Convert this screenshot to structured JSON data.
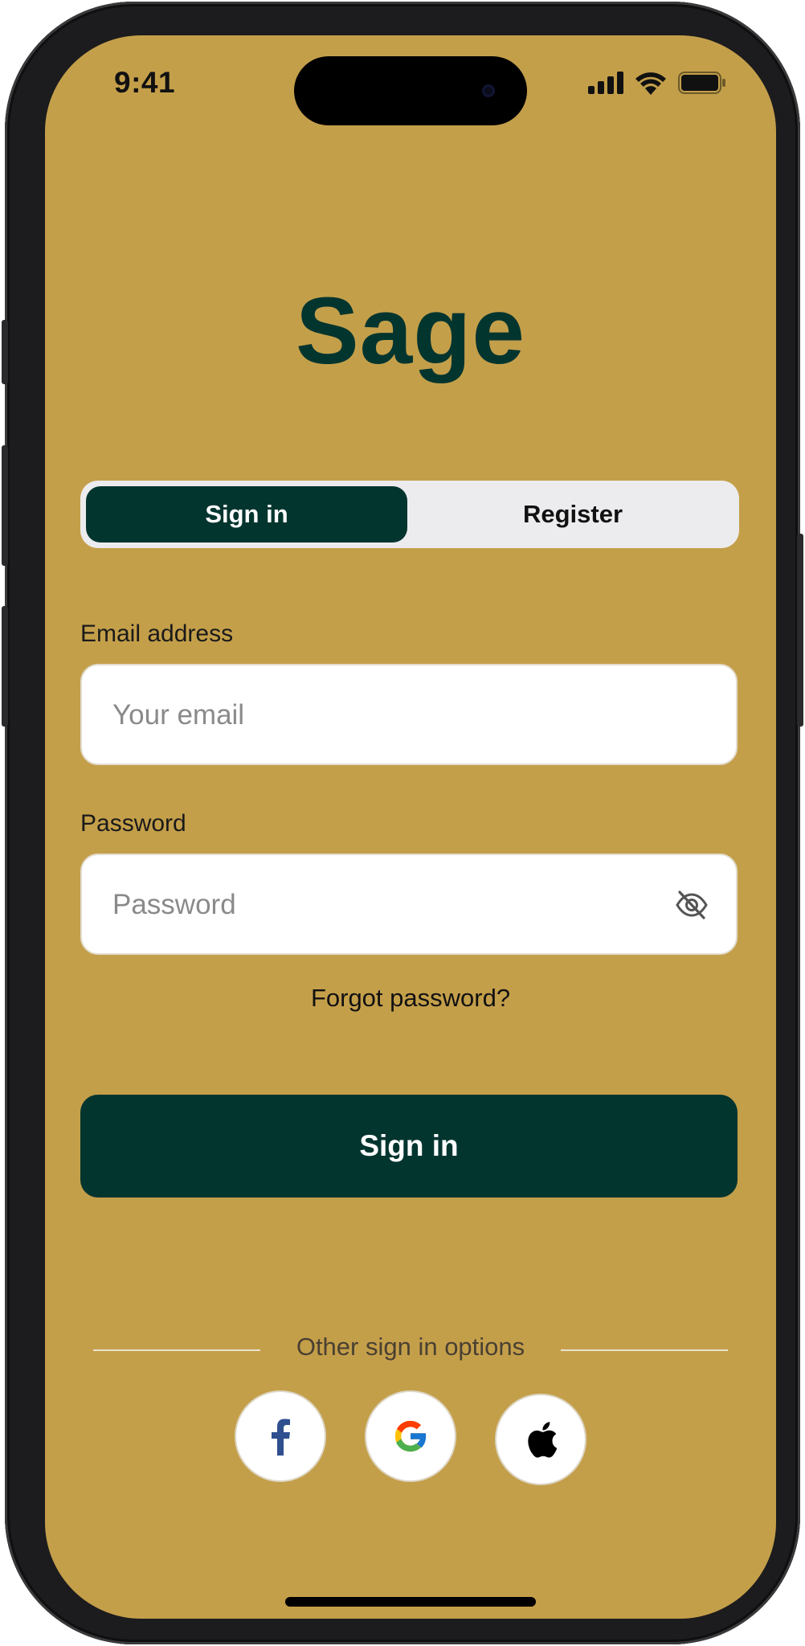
{
  "status_bar": {
    "time": "9:41"
  },
  "app": {
    "title": "Sage"
  },
  "auth_tabs": {
    "sign_in": "Sign in",
    "register": "Register",
    "active": "sign_in"
  },
  "form": {
    "email": {
      "label": "Email address",
      "placeholder": "Your email",
      "value": ""
    },
    "password": {
      "label": "Password",
      "placeholder": "Password",
      "value": ""
    },
    "forgot_link": "Forgot password?",
    "submit_label": "Sign in"
  },
  "other_options": {
    "label": "Other sign in options",
    "providers": [
      {
        "name": "Facebook",
        "icon": "facebook-icon"
      },
      {
        "name": "Google",
        "icon": "google-icon"
      },
      {
        "name": "Apple",
        "icon": "apple-icon"
      }
    ]
  },
  "colors": {
    "background": "#c49f4a",
    "primary": "#03352f",
    "segment_bg": "#ececee"
  }
}
